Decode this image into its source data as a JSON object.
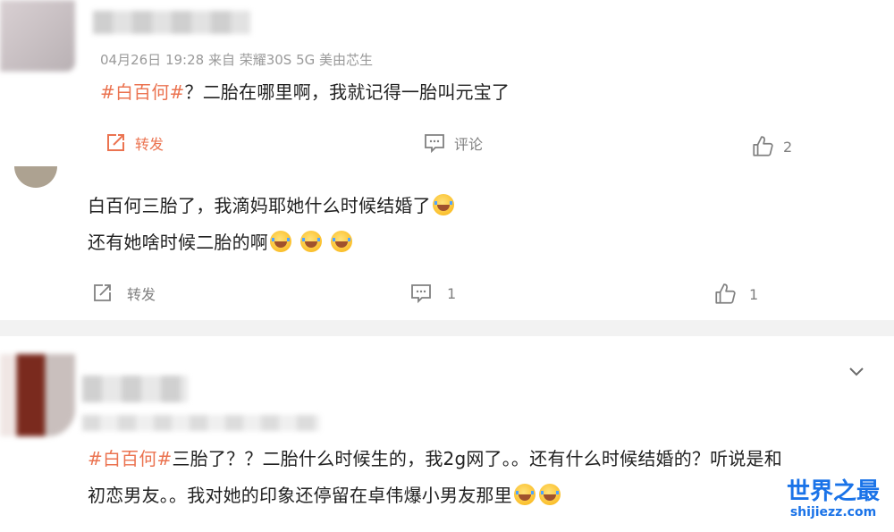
{
  "post1": {
    "meta": "04月26日 19:28  来自 荣耀30S 5G 美由芯生",
    "topic": "#白百何#",
    "body": "？二胎在哪里啊，我就记得一胎叫元宝了",
    "repost_label": "转发",
    "comment_label": "评论",
    "like_count": "2"
  },
  "reply1": {
    "line1": "白百何三胎了，我滴妈耶她什么时候结婚了",
    "line2": "还有她啥时候二胎的啊",
    "repost_label": "转发",
    "comment_count": "1",
    "like_count": "1"
  },
  "post2": {
    "topic": "#白百何#",
    "line1_rest": "三胎了？？二胎什么时候生的，我2g网了。。还有什么时候结婚的？听说是和",
    "line2": "初恋男友。。我对她的印象还停留在卓伟爆小男友那里"
  },
  "watermark": {
    "name": "世界之最",
    "url": "shijiezz.com"
  },
  "icons": {
    "repost": "repost-icon",
    "comment": "comment-icon",
    "like": "thumbs-up-icon",
    "expand": "chevron-down-icon",
    "emoji": "laugh-cry-emoji"
  },
  "colors": {
    "accent": "#eb7350",
    "watermark": "#1a73e8"
  }
}
